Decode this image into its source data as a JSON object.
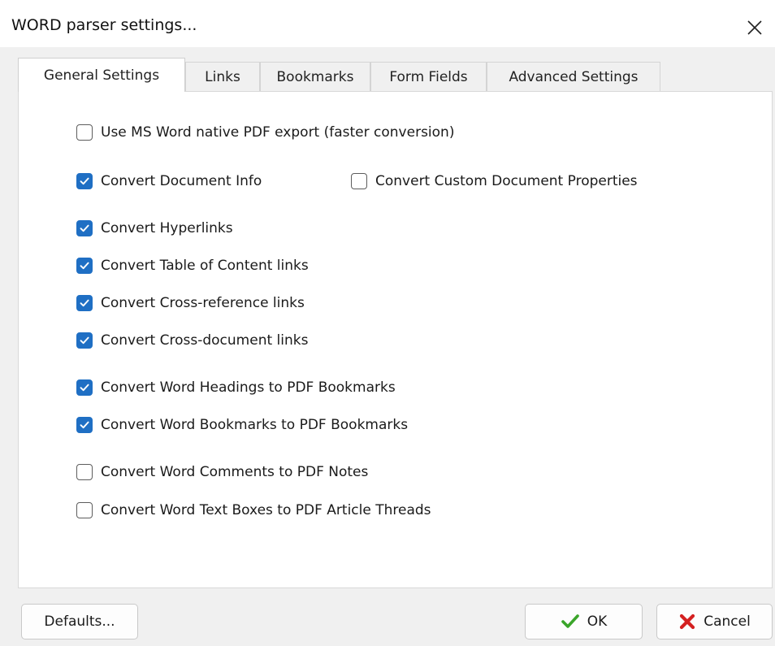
{
  "window": {
    "title": "WORD parser settings...",
    "close_icon": "close-icon"
  },
  "tabs": [
    {
      "label": "General Settings",
      "active": true
    },
    {
      "label": "Links",
      "active": false
    },
    {
      "label": "Bookmarks",
      "active": false
    },
    {
      "label": "Form Fields",
      "active": false
    },
    {
      "label": "Advanced Settings",
      "active": false
    }
  ],
  "options": [
    {
      "label": "Use MS Word native PDF export (faster conversion)",
      "checked": false
    },
    {
      "label": "Convert Document Info",
      "checked": true
    },
    {
      "label": "Convert Custom Document Properties",
      "checked": false
    },
    {
      "label": "Convert Hyperlinks",
      "checked": true
    },
    {
      "label": "Convert Table of Content links",
      "checked": true
    },
    {
      "label": "Convert Cross-reference links",
      "checked": true
    },
    {
      "label": "Convert Cross-document links",
      "checked": true
    },
    {
      "label": "Convert Word Headings to PDF Bookmarks",
      "checked": true
    },
    {
      "label": "Convert Word Bookmarks to PDF Bookmarks",
      "checked": true
    },
    {
      "label": "Convert Word Comments to PDF Notes",
      "checked": false
    },
    {
      "label": "Convert Word Text Boxes to PDF Article Threads",
      "checked": false
    }
  ],
  "buttons": {
    "defaults": "Defaults...",
    "ok": "OK",
    "cancel": "Cancel"
  },
  "colors": {
    "accent": "#1f6fc4",
    "ok_icon": "#3aa52a",
    "cancel_icon": "#d42020"
  }
}
